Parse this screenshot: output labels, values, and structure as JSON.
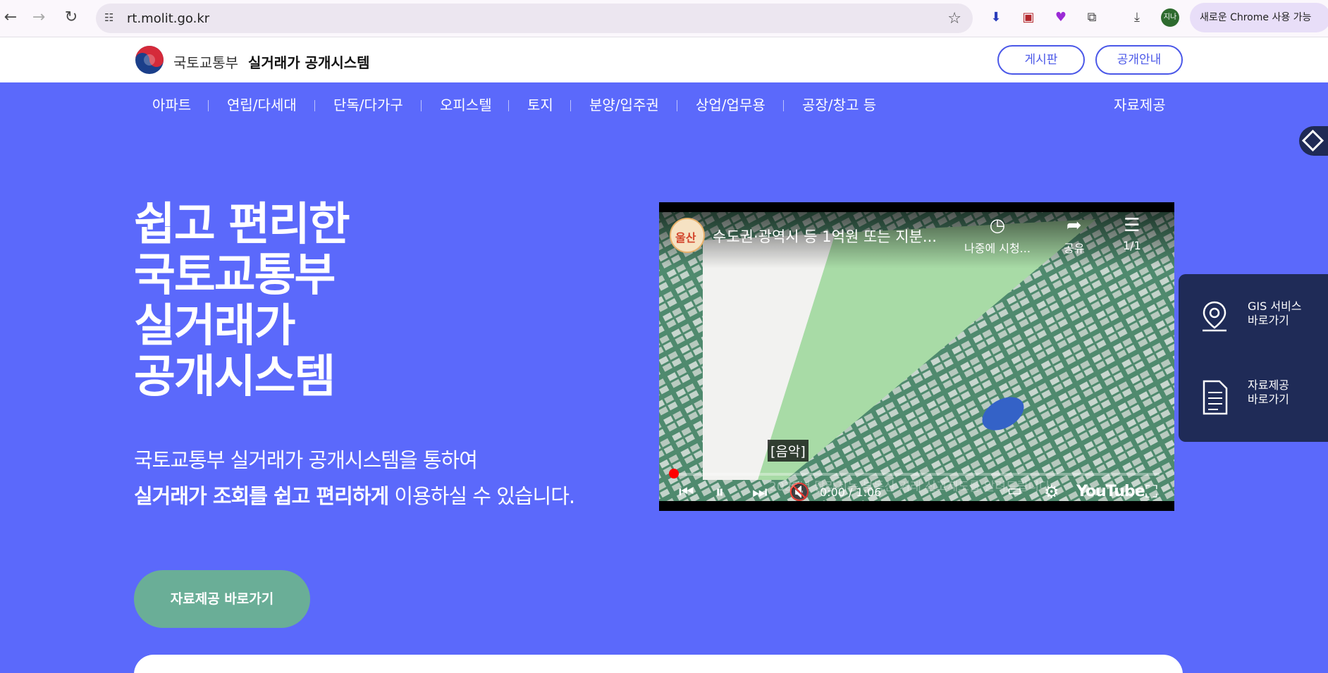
{
  "browser": {
    "url": "rt.molit.go.kr",
    "profile_initials": "지나",
    "update_label": "새로운 Chrome 사용 가능"
  },
  "header": {
    "ministry": "국토교통부",
    "system": "실거래가 공개시스템",
    "board_button": "게시판",
    "info_button": "공개안내"
  },
  "menu": {
    "items": [
      "아파트",
      "연립/다세대",
      "단독/다가구",
      "오피스텔",
      "토지",
      "분양/입주권",
      "상업/업무용",
      "공장/창고 등"
    ],
    "data_link": "자료제공"
  },
  "hero": {
    "title_lines": [
      "쉽고 편리한",
      "국토교통부",
      "실거래가",
      "공개시스템"
    ],
    "sub_line1": "국토교통부 실거래가 공개시스템을 통하여",
    "sub_line2_bold": "실거래가 조회를 쉽고 편리하게",
    "sub_line2_rest": " 이용하실 수 있습니다.",
    "cta": "자료제공 바로가기"
  },
  "video": {
    "title": "수도권·광역시 등 1억원 또는 지분...",
    "watch_later": "나중에 시청...",
    "share": "공유",
    "playlist": "1/1",
    "caption": "[음악]",
    "faded_caption": "2022년 달라지는 부동산 거래 신고제도를 알려드립니다",
    "time": "0:00 / 1:06",
    "progress": 0,
    "brand": "YouTube",
    "channel_badge": "울산"
  },
  "quick_panel": {
    "gis_line1": "GIS 서비스",
    "gis_line2": "바로가기",
    "data_line1": "자료제공",
    "data_line2": "바로가기"
  }
}
